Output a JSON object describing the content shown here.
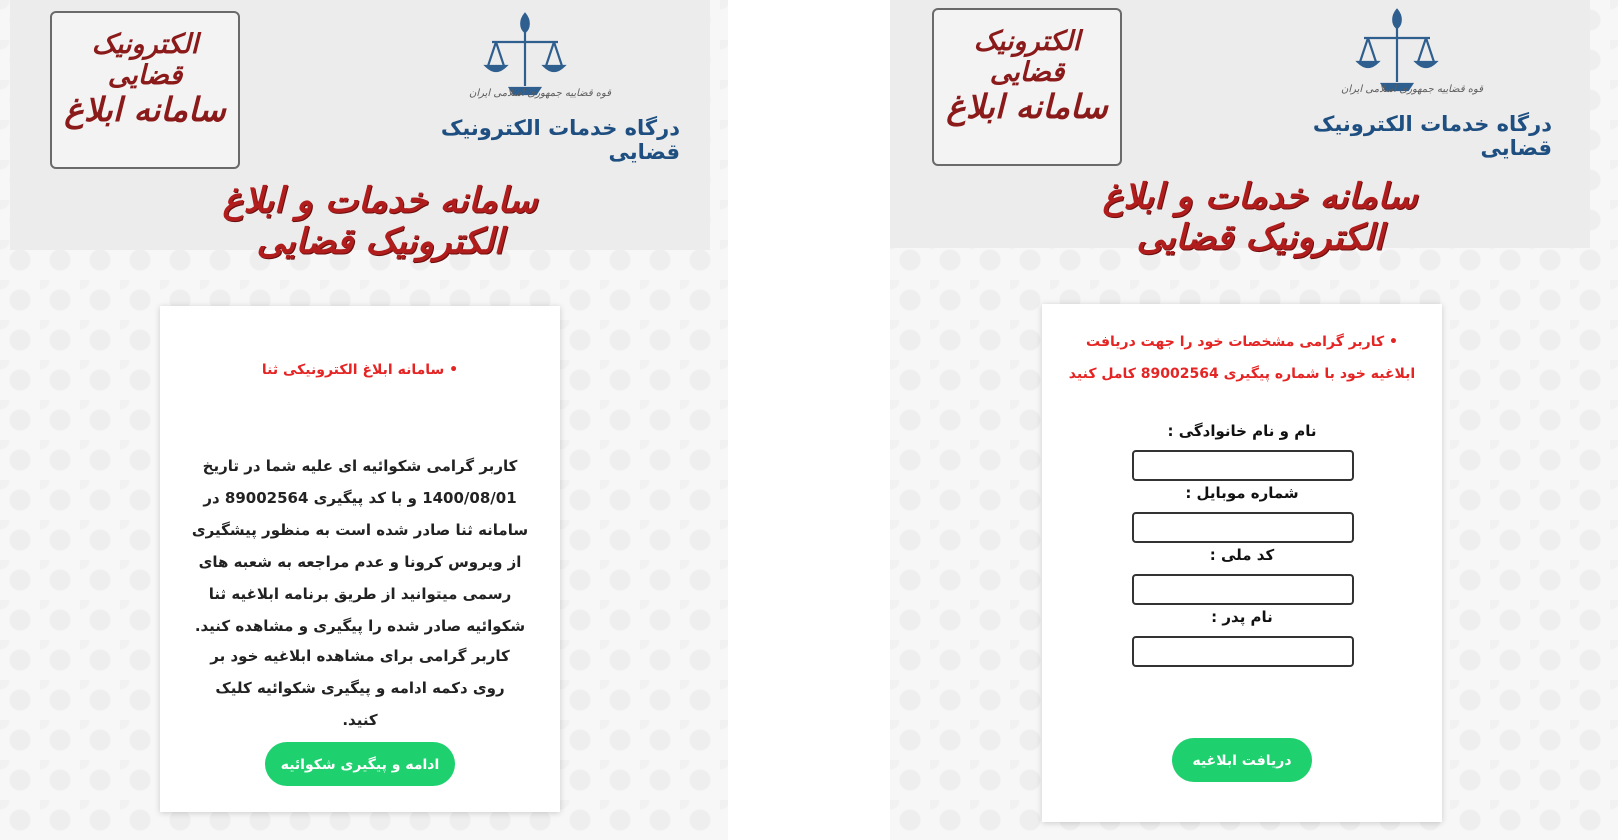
{
  "header": {
    "stamp_line1": "الکترونیک قضایی",
    "stamp_line2": "الکترونیک",
    "stamp_line3": "سامانه ابلاغ",
    "emblem_caption": "قوه قضاییه جمهوری اسلامی ایران",
    "portal_title": "درگاه خدمات الکترونیک قضایی",
    "banner_title": "سامانه خدمات و ابلاغ الکترونیک قضایی"
  },
  "left_panel": {
    "bullet_title": "• سامانه ابلاغ الکترونیکی ثنا",
    "paragraph1": "کاربر گرامی شکوائیه ای علیه شما در تاریخ  1400/08/01 و با کد پیگیری 89002564 در سامانه ثنا صادر شده است به منظور پیشگیری از ویروس کرونا و عدم مراجعه به شعبه های رسمی میتوانید از طریق برنامه ابلاغیه ثنا شکوائیه صادر شده را پیگیری و مشاهده کنید.",
    "paragraph2": "کاربر گرامی برای مشاهده ابلاغیه خود بر روی دکمه ادامه و پیگیری شکوائیه کلیک کنید.",
    "button_label": "ادامه و پیگیری شکوائیه"
  },
  "right_panel": {
    "instruction": "• کاربر گرامی مشخصات خود را جهت دریافت ابلاغیه خود با شماره پیگیری 89002564 کامل کنید",
    "fields": [
      {
        "label": "نام و نام خانوادگی :",
        "value": ""
      },
      {
        "label": "شماره موبایل :",
        "value": ""
      },
      {
        "label": "کد ملی :",
        "value": ""
      },
      {
        "label": "نام پدر :",
        "value": ""
      }
    ],
    "button_label": "دریافت ابلاغیه"
  },
  "colors": {
    "accent_green": "#1ed06e",
    "alert_red": "#e52424",
    "banner_red": "#b11d1d",
    "portal_blue": "#1e4f80"
  },
  "icons": {
    "emblem": "scales-of-justice-emblem-icon"
  }
}
